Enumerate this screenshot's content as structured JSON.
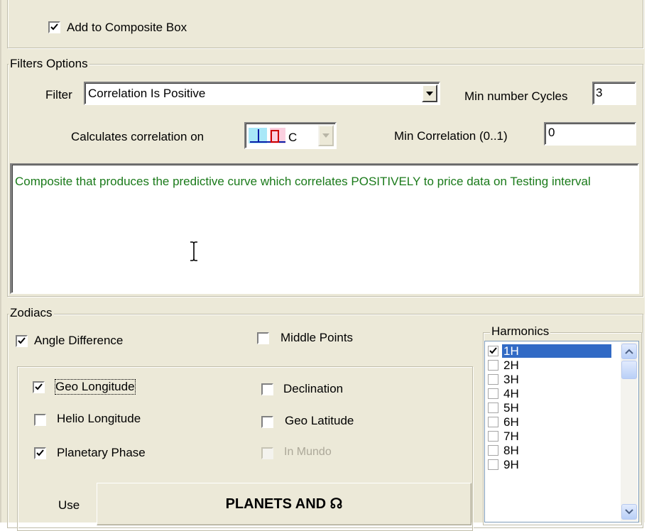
{
  "composite": {
    "add_label": "Add to Composite Box",
    "checked": true
  },
  "filters": {
    "legend": "Filters Options",
    "filter_label": "Filter",
    "filter_value": "Correlation Is Positive",
    "min_cycles_label": "Min number Cycles",
    "min_cycles_value": "3",
    "calc_label": "Calculates correlation on",
    "calc_suffix": "C",
    "min_corr_label": "Min Correlation (0..1)",
    "min_corr_value": "0",
    "description": "Composite that produces the predictive curve which correlates POSITIVELY to price data on Testing interval",
    "description_color": "#1a7a1a"
  },
  "zodiacs": {
    "legend": "Zodiacs",
    "angle_difference": {
      "label": "Angle Difference",
      "checked": true
    },
    "middle_points": {
      "label": "Middle Points",
      "checked": false
    },
    "geo_longitude": {
      "label": "Geo Longitude",
      "checked": true
    },
    "declination": {
      "label": "Declination",
      "checked": false
    },
    "helio_longitude": {
      "label": "Helio Longitude",
      "checked": false
    },
    "geo_latitude": {
      "label": "Geo Latitude",
      "checked": false
    },
    "planetary_phase": {
      "label": "Planetary Phase",
      "checked": true
    },
    "in_mundo": {
      "label": "In Mundo",
      "checked": false,
      "disabled": true
    },
    "use_label": "Use",
    "use_button": "PLANETS AND ☊"
  },
  "harmonics": {
    "legend": "Harmonics",
    "items": [
      {
        "label": "1H",
        "checked": true,
        "selected": true
      },
      {
        "label": "2H",
        "checked": false
      },
      {
        "label": "3H",
        "checked": false
      },
      {
        "label": "4H",
        "checked": false
      },
      {
        "label": "5H",
        "checked": false
      },
      {
        "label": "6H",
        "checked": false
      },
      {
        "label": "7H",
        "checked": false
      },
      {
        "label": "8H",
        "checked": false
      },
      {
        "label": "9H",
        "checked": false
      }
    ]
  },
  "colors": {
    "selection": "#316ac5",
    "panel": "#ece9d8"
  }
}
